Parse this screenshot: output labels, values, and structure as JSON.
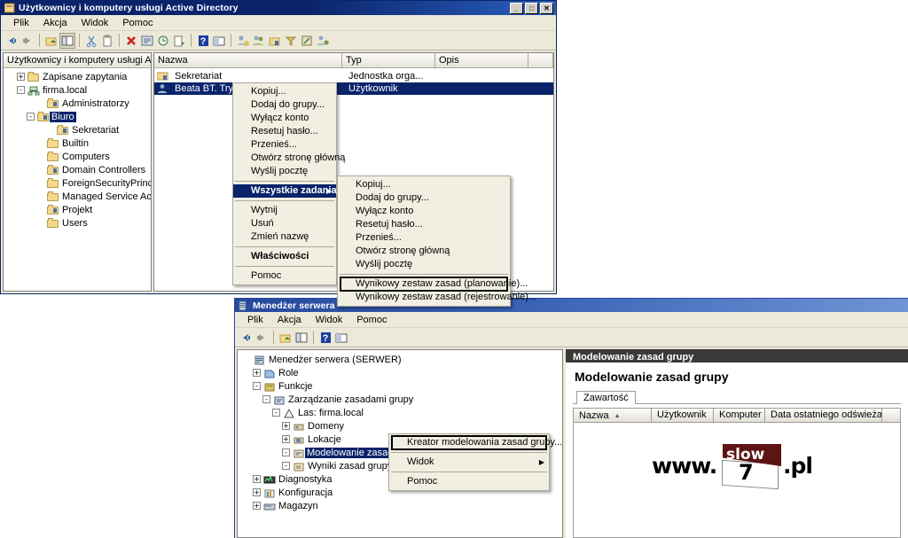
{
  "ad_window": {
    "title": "Użytkownicy i komputery usługi Active Directory",
    "icon": "ad-users-computers-icon",
    "window_buttons": {
      "minimize": "_",
      "maximize": "□",
      "close": "✕"
    },
    "menubar": [
      "Plik",
      "Akcja",
      "Widok",
      "Pomoc"
    ],
    "toolbar_icons": [
      "back-arrow-icon",
      "forward-arrow-icon",
      "up-folder-icon",
      "show-hide-tree-icon",
      "cut-icon",
      "copy-icon",
      "delete-icon",
      "properties-icon",
      "refresh-icon",
      "export-list-icon",
      "help-icon",
      "console-icon",
      "new-user-icon",
      "new-group-icon",
      "new-ou-icon",
      "filter-icon",
      "find-icon",
      "add-to-group-icon"
    ],
    "tree": [
      {
        "label": "Użytkownicy i komputery usługi Act",
        "indent": 0,
        "expander": "",
        "icon": "console-root-icon"
      },
      {
        "label": "Zapisane zapytania",
        "indent": 1,
        "expander": "+",
        "icon": "saved-queries-icon"
      },
      {
        "label": "firma.local",
        "indent": 1,
        "expander": "-",
        "icon": "domain-icon"
      },
      {
        "label": "Administratorzy",
        "indent": 3,
        "expander": "",
        "icon": "ou-icon"
      },
      {
        "label": "Biuro",
        "indent": 2,
        "expander": "-",
        "icon": "ou-icon",
        "selected": true
      },
      {
        "label": "Sekretariat",
        "indent": 4,
        "expander": "",
        "icon": "ou-icon"
      },
      {
        "label": "Builtin",
        "indent": 3,
        "expander": "",
        "icon": "folder-icon"
      },
      {
        "label": "Computers",
        "indent": 3,
        "expander": "",
        "icon": "folder-icon"
      },
      {
        "label": "Domain Controllers",
        "indent": 3,
        "expander": "",
        "icon": "ou-icon"
      },
      {
        "label": "ForeignSecurityPrincipals",
        "indent": 3,
        "expander": "",
        "icon": "folder-icon"
      },
      {
        "label": "Managed Service Accounts",
        "indent": 3,
        "expander": "",
        "icon": "folder-icon"
      },
      {
        "label": "Projekt",
        "indent": 3,
        "expander": "",
        "icon": "ou-icon"
      },
      {
        "label": "Users",
        "indent": 3,
        "expander": "",
        "icon": "folder-icon"
      }
    ],
    "list_columns": [
      "Nazwa",
      "Typ",
      "Opis"
    ],
    "list_rows": [
      {
        "name": "Sekretariat",
        "type": "Jednostka orga...",
        "desc": "",
        "icon": "ou-icon",
        "selected": false
      },
      {
        "name": "Beata BT. Tryla",
        "type": "Użytkownik",
        "desc": "",
        "icon": "user-icon",
        "selected": true
      }
    ]
  },
  "context_menu_main": {
    "name": "user-context-menu",
    "items": [
      {
        "label": "Kopiuj...",
        "type": "item"
      },
      {
        "label": "Dodaj do grupy...",
        "type": "item"
      },
      {
        "label": "Wyłącz konto",
        "type": "item"
      },
      {
        "label": "Resetuj hasło...",
        "type": "item"
      },
      {
        "label": "Przenieś...",
        "type": "item"
      },
      {
        "label": "Otwórz stronę główną",
        "type": "item"
      },
      {
        "label": "Wyślij pocztę",
        "type": "item"
      },
      {
        "label": "",
        "type": "separator"
      },
      {
        "label": "Wszystkie zadania",
        "type": "submenu",
        "highlighted": true
      },
      {
        "label": "",
        "type": "separator"
      },
      {
        "label": "Wytnij",
        "type": "item"
      },
      {
        "label": "Usuń",
        "type": "item"
      },
      {
        "label": "Zmień nazwę",
        "type": "item"
      },
      {
        "label": "",
        "type": "separator"
      },
      {
        "label": "Właściwości",
        "type": "item",
        "bold": true
      },
      {
        "label": "",
        "type": "separator"
      },
      {
        "label": "Pomoc",
        "type": "item"
      }
    ]
  },
  "context_menu_sub": {
    "name": "all-tasks-submenu",
    "items": [
      {
        "label": "Kopiuj...",
        "type": "item"
      },
      {
        "label": "Dodaj do grupy...",
        "type": "item"
      },
      {
        "label": "Wyłącz konto",
        "type": "item"
      },
      {
        "label": "Resetuj hasło...",
        "type": "item"
      },
      {
        "label": "Przenieś...",
        "type": "item"
      },
      {
        "label": "Otwórz stronę główną",
        "type": "item"
      },
      {
        "label": "Wyślij pocztę",
        "type": "item"
      },
      {
        "label": "",
        "type": "separator"
      },
      {
        "label": "Wynikowy zestaw zasad (planowanie)...",
        "type": "item",
        "boxed": true
      },
      {
        "label": "Wynikowy zestaw zasad (rejestrowanie)...",
        "type": "item"
      }
    ]
  },
  "sm_window": {
    "title": "Menedżer serwera",
    "icon": "server-manager-icon",
    "menubar": [
      "Plik",
      "Akcja",
      "Widok",
      "Pomoc"
    ],
    "toolbar_icons": [
      "back-arrow-icon",
      "forward-arrow-icon",
      "up-folder-icon",
      "show-hide-tree-icon",
      "help-icon",
      "console-icon"
    ],
    "tree": [
      {
        "label": "Menedżer serwera (SERWER)",
        "indent": 0,
        "expander": "",
        "icon": "server-icon"
      },
      {
        "label": "Role",
        "indent": 1,
        "expander": "+",
        "icon": "roles-icon"
      },
      {
        "label": "Funkcje",
        "indent": 1,
        "expander": "-",
        "icon": "features-icon"
      },
      {
        "label": "Zarządzanie zasadami grupy",
        "indent": 2,
        "expander": "-",
        "icon": "gpmc-icon"
      },
      {
        "label": "Las: firma.local",
        "indent": 3,
        "expander": "-",
        "icon": "forest-icon"
      },
      {
        "label": "Domeny",
        "indent": 4,
        "expander": "+",
        "icon": "domains-icon"
      },
      {
        "label": "Lokacje",
        "indent": 4,
        "expander": "+",
        "icon": "sites-icon"
      },
      {
        "label": "Modelowanie zasad grupy",
        "indent": 4,
        "expander": "-",
        "icon": "modeling-icon",
        "selected": true
      },
      {
        "label": "Wyniki zasad grupy",
        "indent": 4,
        "expander": "-",
        "icon": "results-icon"
      },
      {
        "label": "Diagnostyka",
        "indent": 1,
        "expander": "+",
        "icon": "diagnostics-icon"
      },
      {
        "label": "Konfiguracja",
        "indent": 1,
        "expander": "+",
        "icon": "configuration-icon"
      },
      {
        "label": "Magazyn",
        "indent": 1,
        "expander": "+",
        "icon": "storage-icon"
      }
    ],
    "context_menu": {
      "name": "modeling-context-menu",
      "items": [
        {
          "label": "Kreator modelowania zasad grupy...",
          "type": "item",
          "boxed": true
        },
        {
          "label": "",
          "type": "separator"
        },
        {
          "label": "Widok",
          "type": "submenu"
        },
        {
          "label": "",
          "type": "separator"
        },
        {
          "label": "Pomoc",
          "type": "item"
        }
      ]
    },
    "right_panel": {
      "header": "Modelowanie zasad grupy",
      "heading": "Modelowanie zasad grupy",
      "tabs": [
        "Zawartość"
      ],
      "grid_columns": [
        "Nazwa",
        "Użytkownik",
        "Komputer",
        "Data ostatniego odświeżania"
      ],
      "sort_column": "Nazwa",
      "sort_direction": "asc",
      "rows": [],
      "watermark": {
        "prefix": "www.",
        "flag_text": "slow",
        "number": "7",
        "suffix": ".pl"
      }
    }
  },
  "colors": {
    "titlebar_ad": "#0a246a",
    "titlebar_sm": "#27489c",
    "selection": "#0a246a",
    "chrome": "#ece9d8",
    "menu_bg": "#f1efe2",
    "watermark_flag": "#5c1414",
    "panel_header": "#3a3a3a"
  }
}
